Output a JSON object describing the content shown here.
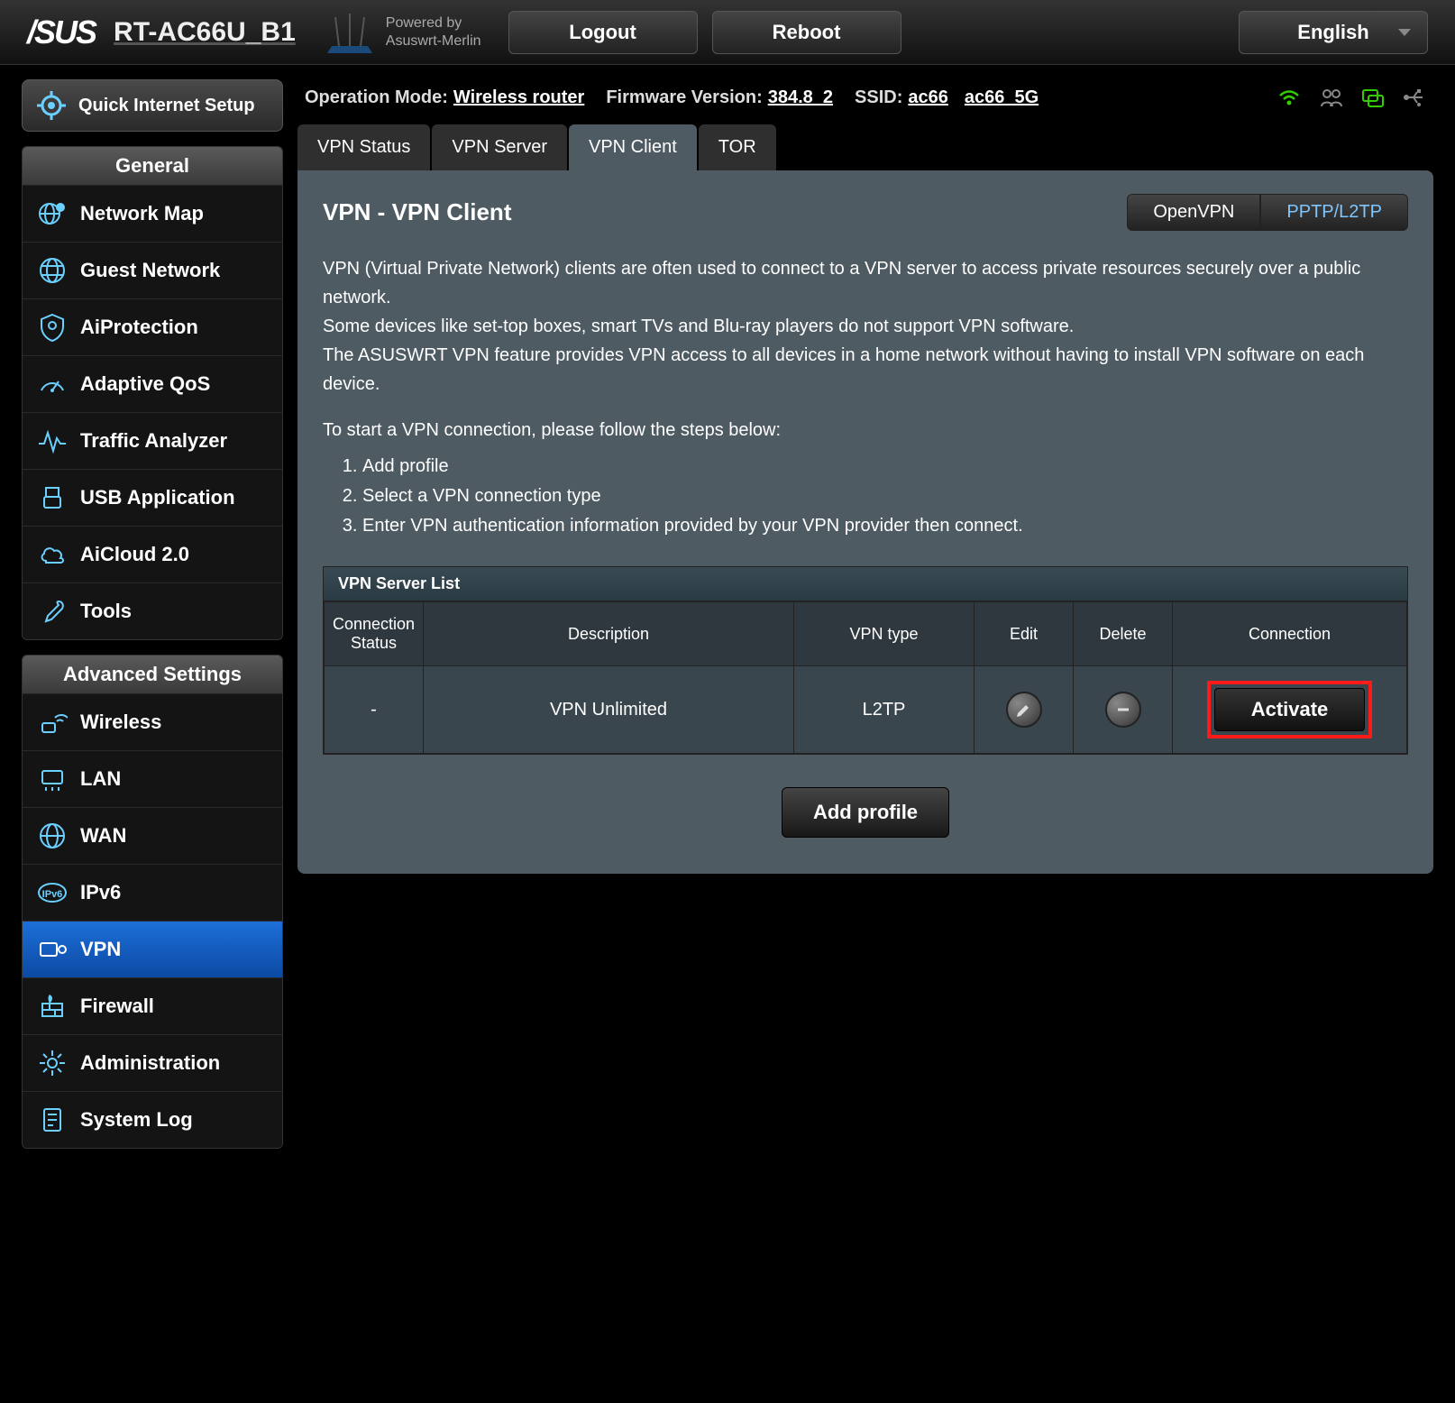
{
  "header": {
    "logo": "/SUS",
    "model": "RT-AC66U_B1",
    "powered_line1": "Powered by",
    "powered_line2": "Asuswrt-Merlin",
    "logout": "Logout",
    "reboot": "Reboot",
    "language": "English"
  },
  "left": {
    "qis": "Quick Internet Setup",
    "general_hdr": "General",
    "general_items": [
      "Network Map",
      "Guest Network",
      "AiProtection",
      "Adaptive QoS",
      "Traffic Analyzer",
      "USB Application",
      "AiCloud 2.0",
      "Tools"
    ],
    "advanced_hdr": "Advanced Settings",
    "advanced_items": [
      "Wireless",
      "LAN",
      "WAN",
      "IPv6",
      "VPN",
      "Firewall",
      "Administration",
      "System Log"
    ],
    "active_advanced_index": 4
  },
  "statusbar": {
    "op_mode_lbl": "Operation Mode:",
    "op_mode": "Wireless router",
    "fw_lbl": "Firmware Version:",
    "fw": "384.8_2",
    "ssid_lbl": "SSID:",
    "ssid1": "ac66",
    "ssid2": "ac66_5G"
  },
  "tabs": [
    "VPN Status",
    "VPN Server",
    "VPN Client",
    "TOR"
  ],
  "active_tab_index": 2,
  "panel": {
    "title": "VPN - VPN Client",
    "mode_openvpn": "OpenVPN",
    "mode_pptp": "PPTP/L2TP",
    "desc_p1": "VPN (Virtual Private Network) clients are often used to connect to a VPN server to access private resources securely over a public network.",
    "desc_p2": "Some devices like set-top boxes, smart TVs and Blu-ray players do not support VPN software.",
    "desc_p3": "The ASUSWRT VPN feature provides VPN access to all devices in a home network without having to install VPN software on each device.",
    "steps_intro": "To start a VPN connection, please follow the steps below:",
    "steps": [
      "Add profile",
      "Select a VPN connection type",
      "Enter VPN authentication information provided by your VPN provider then connect."
    ],
    "table_title": "VPN Server List",
    "table_headers": [
      "Connection Status",
      "Description",
      "VPN type",
      "Edit",
      "Delete",
      "Connection"
    ],
    "table_rows": [
      {
        "status": "-",
        "description": "VPN Unlimited",
        "vpn_type": "L2TP",
        "action": "Activate"
      }
    ],
    "add_profile": "Add profile"
  }
}
